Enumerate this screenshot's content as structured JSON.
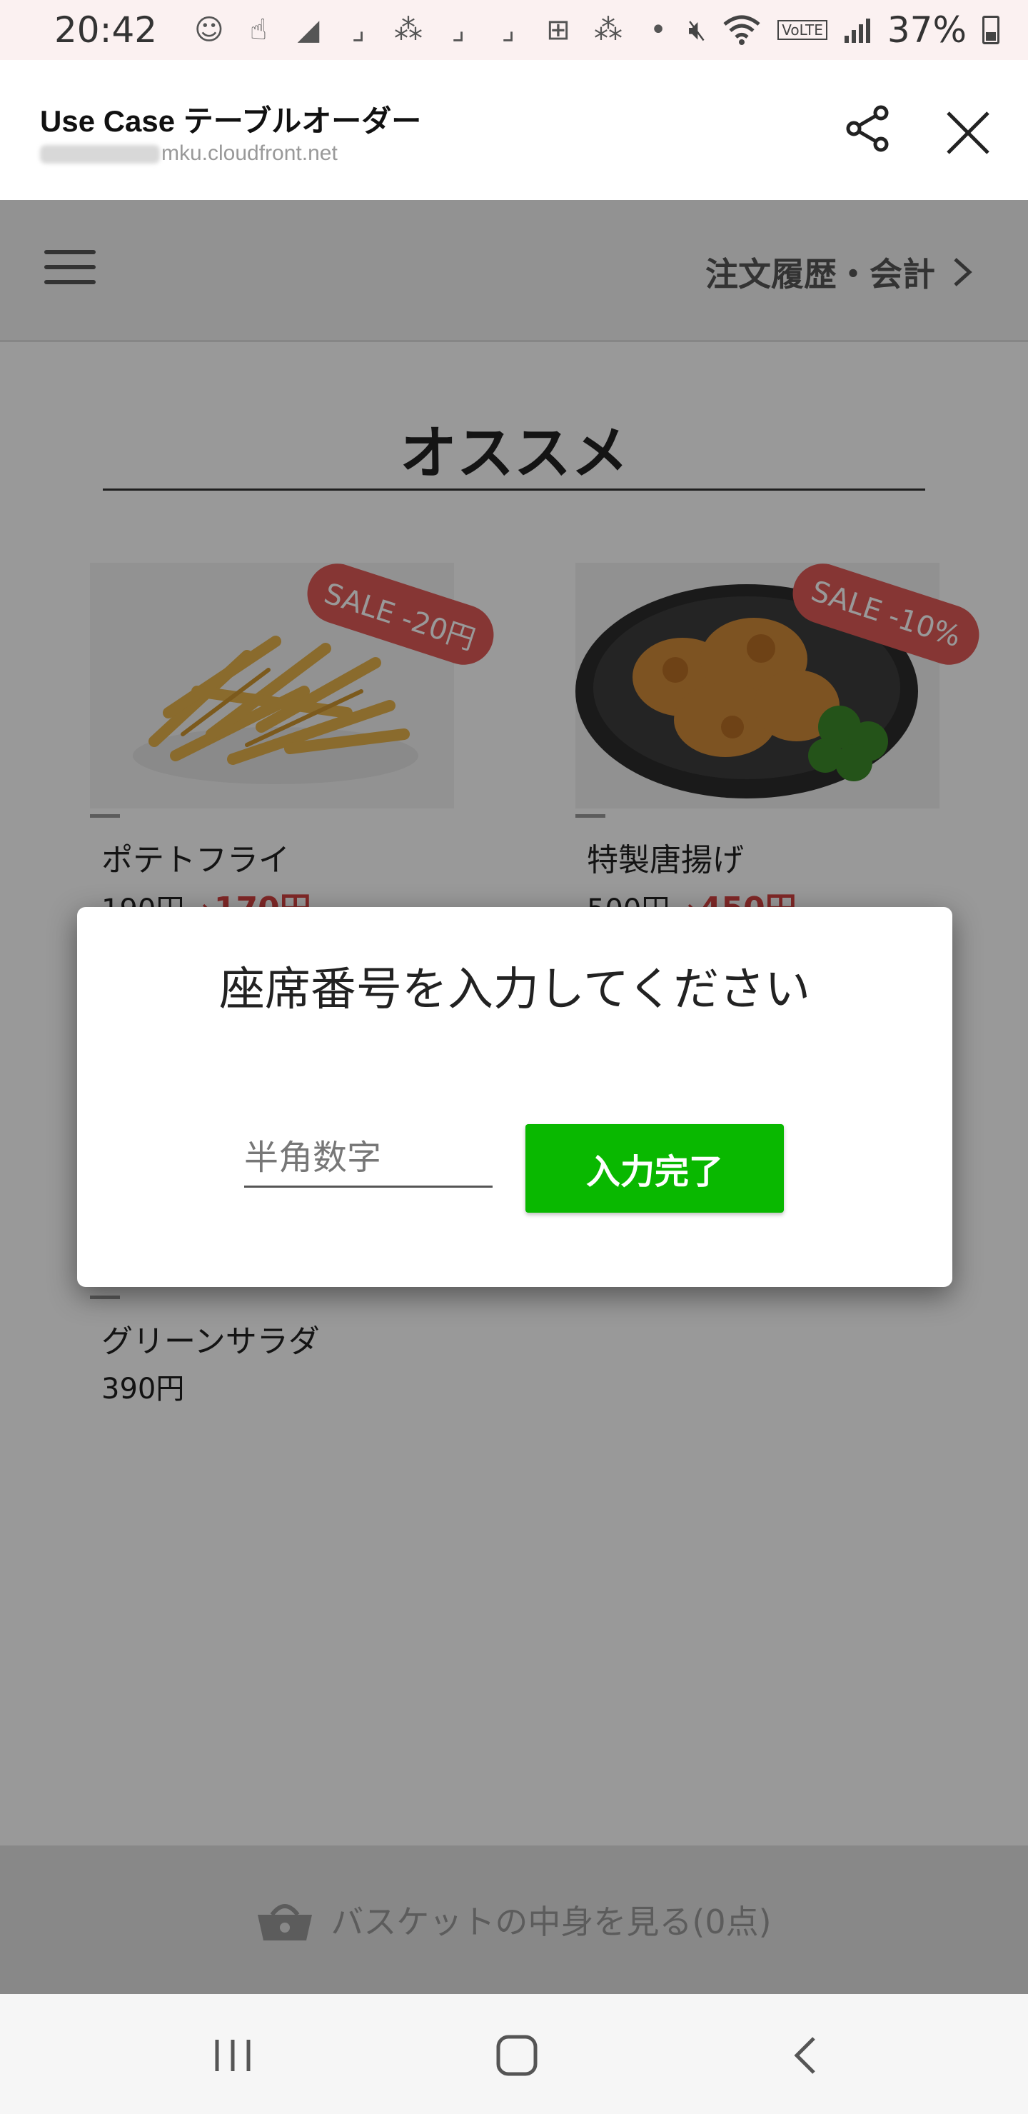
{
  "status_bar": {
    "time": "20:42",
    "battery": "37%",
    "notification_icons": [
      "bixby-icon",
      "gesture-icon",
      "triangle-app-icon",
      "corner-app-icon",
      "slack-icon",
      "corner-app-icon",
      "corner-app-icon",
      "plus-app-icon",
      "slack-icon",
      "more-dot-icon"
    ],
    "system_icons": [
      "mute-icon",
      "wifi-icon",
      "volte-icon",
      "signal-icon",
      "battery-icon"
    ]
  },
  "browser": {
    "title": "Use Case テーブルオーダー",
    "url_visible": "mku.cloudfront.net",
    "share_icon": "share-icon",
    "close_icon": "close-icon"
  },
  "site_header": {
    "menu_icon": "hamburger-icon",
    "history_label": "注文履歴・会計",
    "history_icon": "chevron-right-icon"
  },
  "section": {
    "title": "オススメ"
  },
  "products": [
    {
      "name": "ポテトフライ",
      "old_price": "190円",
      "arrow": "→",
      "new_price": "170円",
      "badge": "SALE -20円"
    },
    {
      "name": "特製唐揚げ",
      "old_price": "500円",
      "arrow": "→",
      "new_price": "450円",
      "badge": "SALE -10%"
    },
    {
      "name": "グリーンサラダ",
      "price": "390円"
    }
  ],
  "basket": {
    "label": "バスケットの中身を見る(0点)",
    "icon": "basket-icon"
  },
  "dialog": {
    "title": "座席番号を入力してください",
    "input_placeholder": "半角数字",
    "input_value": "",
    "submit_label": "入力完了"
  },
  "nav_bar": {
    "buttons": [
      "recent-apps-icon",
      "home-icon",
      "back-icon"
    ]
  },
  "colors": {
    "accent_green": "#09b800",
    "sale_red": "#d64441",
    "overlay": "rgba(0,0,0,0.40)"
  }
}
